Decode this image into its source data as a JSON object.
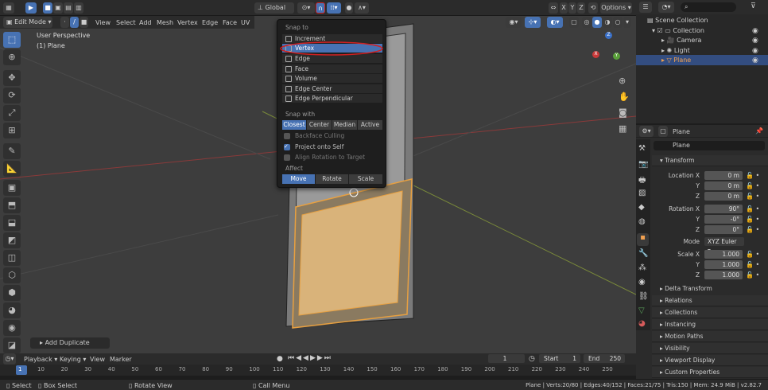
{
  "top_header": {
    "transform_orientation": "Global",
    "axis_buttons": [
      "X",
      "Y",
      "Z"
    ],
    "options_label": "Options"
  },
  "viewport_header": {
    "mode": "Edit Mode",
    "menus": [
      "View",
      "Select",
      "Add",
      "Mesh",
      "Vertex",
      "Edge",
      "Face",
      "UV"
    ]
  },
  "viewport": {
    "view_name": "User Perspective",
    "object_label": "(1) Plane",
    "operator_panel": "Add Duplicate"
  },
  "snap_menu": {
    "snap_to_title": "Snap to",
    "snap_to_items": [
      "Increment",
      "Vertex",
      "Edge",
      "Face",
      "Volume",
      "Edge Center",
      "Edge Perpendicular"
    ],
    "selected_item": "Vertex",
    "snap_with_title": "Snap with",
    "snap_with_options": [
      "Closest",
      "Center",
      "Median",
      "Active"
    ],
    "snap_with_selected": "Closest",
    "checkboxes": [
      {
        "label": "Backface Culling",
        "checked": false
      },
      {
        "label": "Project onto Self",
        "checked": true
      },
      {
        "label": "Align Rotation to Target",
        "checked": false
      }
    ],
    "affect_title": "Affect",
    "affect_options": [
      "Move",
      "Rotate",
      "Scale"
    ],
    "affect_selected": "Move"
  },
  "outliner": {
    "items": [
      "Scene Collection",
      "Collection",
      "Camera",
      "Light",
      "Plane"
    ]
  },
  "properties": {
    "object_name_header": "Plane",
    "object_name_field": "Plane",
    "transform_title": "Transform",
    "location": {
      "label": "Location X",
      "x": "0 m",
      "y": "0 m",
      "z": "0 m"
    },
    "rotation": {
      "label": "Rotation X",
      "x": "90°",
      "y": "-0°",
      "z": "0°"
    },
    "mode_label": "Mode",
    "mode_value": "XYZ Euler",
    "scale": {
      "label": "Scale X",
      "x": "1.000",
      "y": "1.000",
      "z": "1.000"
    },
    "axis_y": "Y",
    "axis_z": "Z",
    "delta_transform": "Delta Transform",
    "panels": [
      "Relations",
      "Collections",
      "Instancing",
      "Motion Paths",
      "Visibility",
      "Viewport Display",
      "Custom Properties"
    ]
  },
  "timeline": {
    "menus": [
      "Playback",
      "Keying",
      "View",
      "Marker"
    ],
    "current_frame": "1",
    "start_label": "Start",
    "start_value": "1",
    "end_label": "End",
    "end_value": "250",
    "ruler_ticks": [
      "1",
      "10",
      "20",
      "30",
      "40",
      "50",
      "60",
      "70",
      "80",
      "90",
      "100",
      "110",
      "120",
      "130",
      "140",
      "150",
      "160",
      "170",
      "180",
      "190",
      "200",
      "210",
      "220",
      "230",
      "240",
      "250"
    ]
  },
  "statusbar": {
    "select": "Select",
    "box_select": "Box Select",
    "rotate_view": "Rotate View",
    "call_menu": "Call Menu",
    "stats": "Plane | Verts:20/80 | Edges:40/152 | Faces:21/75 | Tris:150 | Mem: 24.9 MiB | v2.82.7"
  },
  "colors": {
    "accent": "#4772b3",
    "selection_orange": "#e8a040",
    "highlight_ring": "#d02020"
  }
}
